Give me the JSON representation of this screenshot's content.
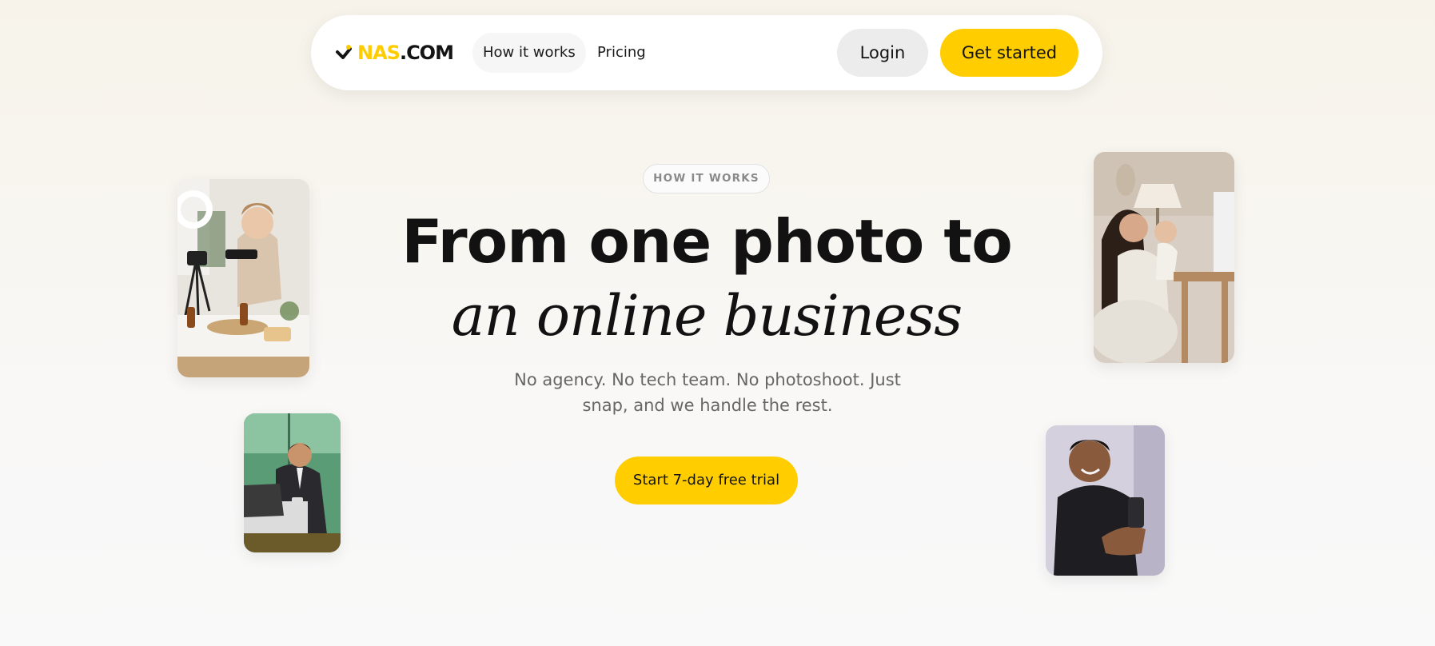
{
  "nav": {
    "logo": {
      "prefix": "NAS",
      "suffix": ".COM"
    },
    "links": [
      {
        "label": "How it works",
        "active": true
      },
      {
        "label": "Pricing",
        "active": false
      }
    ],
    "login_label": "Login",
    "get_started_label": "Get started"
  },
  "hero": {
    "badge": "HOW IT WORKS",
    "title_line1": "From one photo to",
    "title_line2": "an online business",
    "subtitle_line1": "No agency. No tech team. No photoshoot. Just",
    "subtitle_line2": "snap, and we handle the rest.",
    "cta_label": "Start 7-day free trial"
  },
  "colors": {
    "accent": "#ffcd00",
    "text": "#141414",
    "muted": "#666666"
  }
}
